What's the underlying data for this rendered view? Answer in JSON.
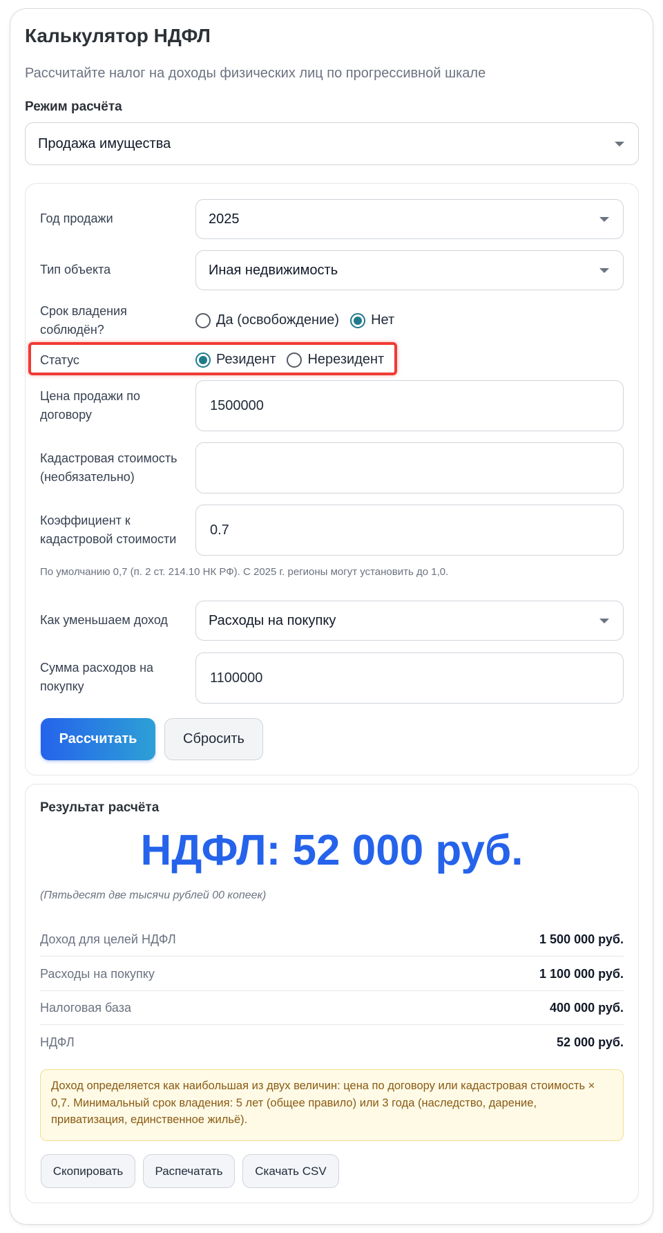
{
  "header": {
    "title": "Калькулятор НДФЛ",
    "subtitle": "Рассчитайте налог на доходы физических лиц по прогрессивной шкале"
  },
  "mode": {
    "label": "Режим расчёта",
    "value": "Продажа имущества"
  },
  "form": {
    "year": {
      "label": "Год продажи",
      "value": "2025"
    },
    "object_type": {
      "label": "Тип объекта",
      "value": "Иная недвижимость"
    },
    "ownership": {
      "label_line1": "Срок владения",
      "label_line2": "соблюдён?",
      "options": [
        "Да (освобождение)",
        "Нет"
      ],
      "selected": "Нет"
    },
    "status": {
      "label": "Статус",
      "options": [
        "Резидент",
        "Нерезидент"
      ],
      "selected": "Резидент"
    },
    "price": {
      "label_line1": "Цена продажи по",
      "label_line2": "договору",
      "value": "1500000"
    },
    "cadastral": {
      "label_line1": "Кадастровая стоимость",
      "label_line2": "(необязательно)",
      "value": ""
    },
    "coefficient": {
      "label_line1": "Коэффициент к",
      "label_line2": "кадастровой стоимости",
      "value": "0.7"
    },
    "hint": "По умолчанию 0,7 (п. 2 ст. 214.10 НК РФ). С 2025 г. регионы могут установить до 1,0.",
    "reduce": {
      "label": "Как уменьшаем доход",
      "value": "Расходы на покупку"
    },
    "expenses": {
      "label_line1": "Сумма расходов на",
      "label_line2": "покупку",
      "value": "1100000"
    },
    "calculate_label": "Рассчитать",
    "reset_label": "Сбросить"
  },
  "result": {
    "title": "Результат расчёта",
    "headline": "НДФЛ: 52 000 руб.",
    "in_words": "(Пятьдесят две тысячи рублей 00 копеек)",
    "rows": [
      {
        "label": "Доход для целей НДФЛ",
        "value": "1 500 000 руб."
      },
      {
        "label": "Расходы на покупку",
        "value": "1 100 000 руб."
      },
      {
        "label": "Налоговая база",
        "value": "400 000 руб."
      },
      {
        "label": "НДФЛ",
        "value": "52 000 руб."
      }
    ],
    "note": "Доход определяется как наибольшая из двух величин: цена по договору или кадастровая стоимость × 0,7. Минимальный срок владения: 5 лет (общее правило) или 3 года (наследство, дарение, приватизация, единственное жильё).",
    "copy_label": "Скопировать",
    "print_label": "Распечатать",
    "csv_label": "Скачать CSV"
  },
  "colors": {
    "accent": "#2563eb",
    "radio_selected": "#1f7a8c",
    "highlight": "#ef3b34",
    "note_bg": "#fefae6",
    "note_text": "#8a5a12"
  }
}
